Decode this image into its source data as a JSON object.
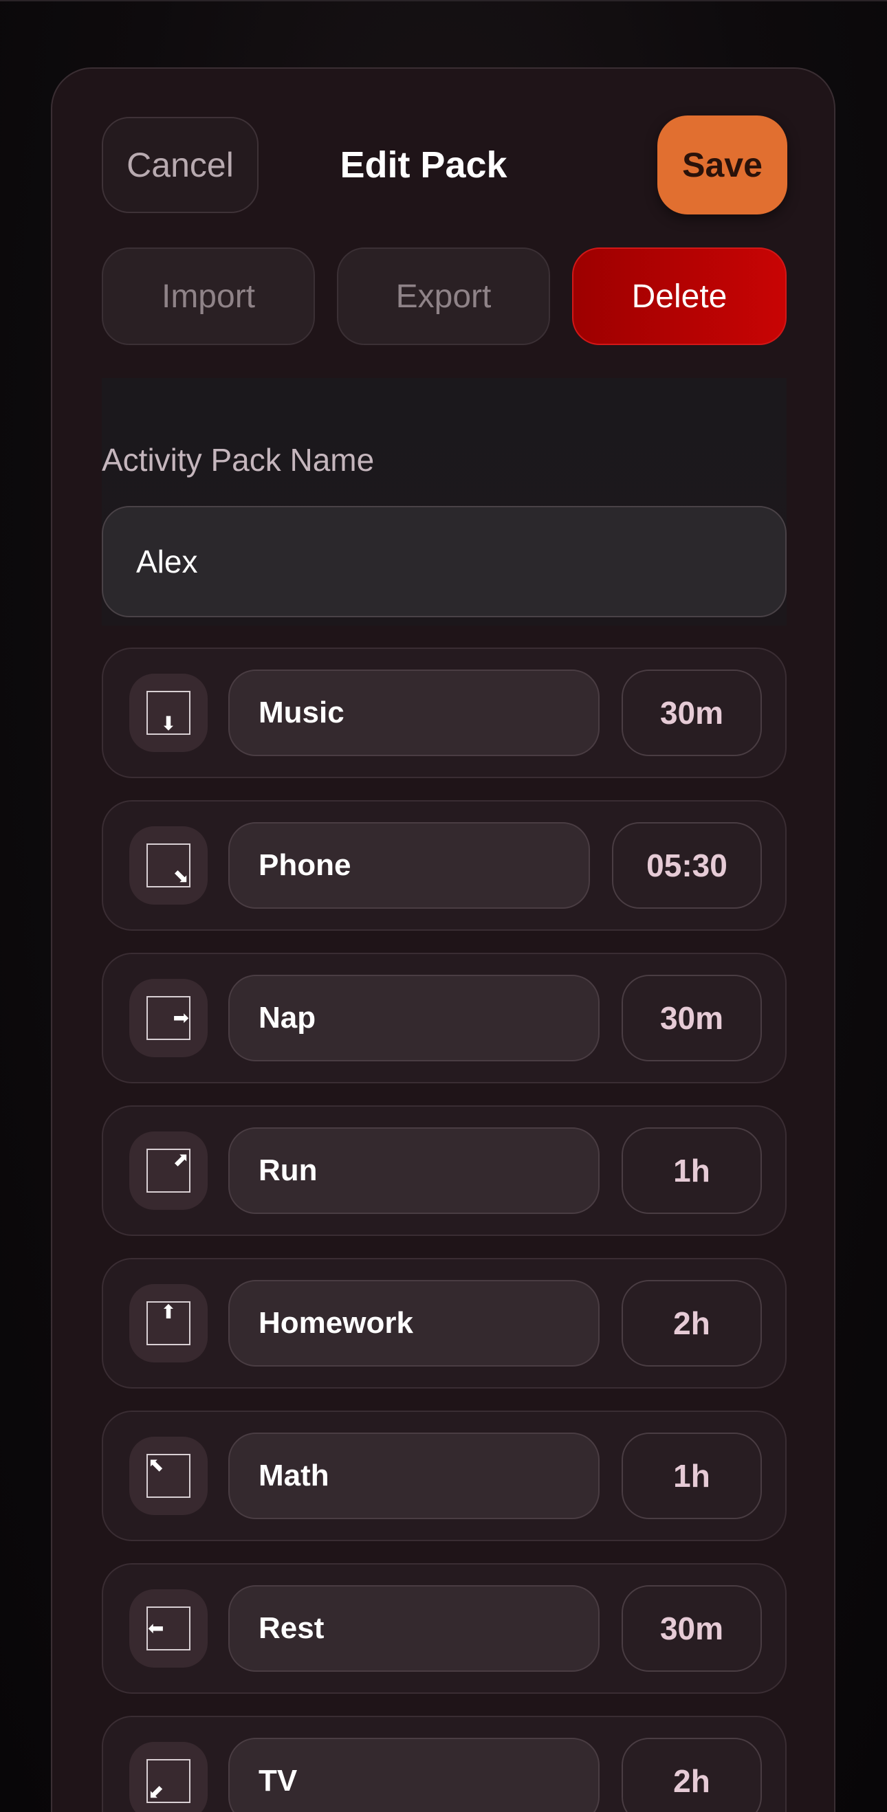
{
  "header": {
    "cancel_label": "Cancel",
    "title": "Edit Pack",
    "save_label": "Save"
  },
  "actions": {
    "import_label": "Import",
    "export_label": "Export",
    "delete_label": "Delete"
  },
  "pack": {
    "name_label": "Activity Pack Name",
    "name_value": "Alex"
  },
  "activities": [
    {
      "name": "Music",
      "duration": "30m",
      "arrow": "⬇",
      "icon": "arrow-down-icon"
    },
    {
      "name": "Phone",
      "duration": "05:30",
      "arrow": "⬊",
      "icon": "arrow-down-right-icon"
    },
    {
      "name": "Nap",
      "duration": "30m",
      "arrow": "➡",
      "icon": "arrow-right-icon"
    },
    {
      "name": "Run",
      "duration": "1h",
      "arrow": "⬈",
      "icon": "arrow-up-right-icon"
    },
    {
      "name": "Homework",
      "duration": "2h",
      "arrow": "⬆",
      "icon": "arrow-up-icon"
    },
    {
      "name": "Math",
      "duration": "1h",
      "arrow": "⬉",
      "icon": "arrow-up-left-icon"
    },
    {
      "name": "Rest",
      "duration": "30m",
      "arrow": "⬅",
      "icon": "arrow-left-icon"
    },
    {
      "name": "TV",
      "duration": "2h",
      "arrow": "⬋",
      "icon": "arrow-down-left-icon"
    }
  ],
  "colors": {
    "accent_save": "#e16f30",
    "danger_delete": "#c80404",
    "sheet_background": "#1f1418"
  }
}
